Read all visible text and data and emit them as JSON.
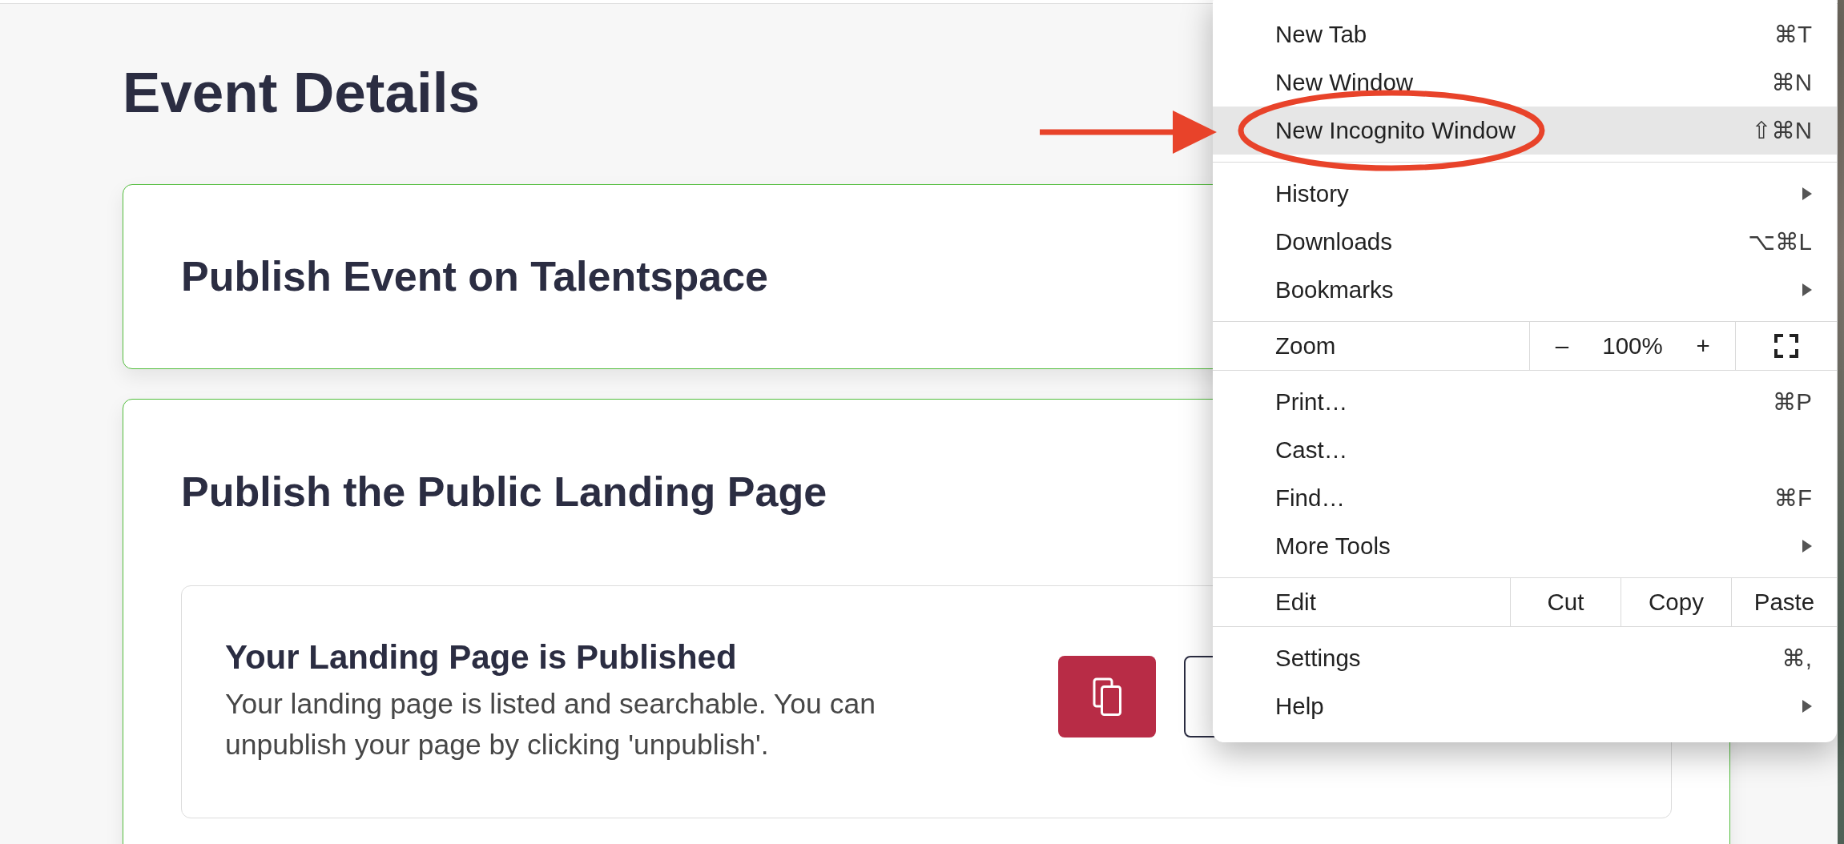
{
  "page": {
    "title": "Event Details"
  },
  "cards": [
    {
      "title": "Publish Event on Talentspace"
    },
    {
      "title": "Publish the Public Landing Page",
      "notice": {
        "title": "Your Landing Page is Published",
        "text": "Your landing page is listed and searchable. You can unpublish your page by clicking 'unpublish'.",
        "actions": [
          {
            "kind": "copy"
          },
          {
            "kind": "outline"
          }
        ]
      }
    }
  ],
  "menu": {
    "sections": [
      {
        "kind": "list",
        "items": [
          {
            "label": "New Tab",
            "shortcut": "⌘T",
            "submenu": false,
            "highlighted": false,
            "circled": false
          },
          {
            "label": "New Window",
            "shortcut": "⌘N",
            "submenu": false,
            "highlighted": false,
            "circled": false
          },
          {
            "label": "New Incognito Window",
            "shortcut": "⇧⌘N",
            "submenu": false,
            "highlighted": true,
            "circled": true
          }
        ]
      },
      {
        "kind": "list",
        "items": [
          {
            "label": "History",
            "submenu": true,
            "highlighted": false,
            "circled": false
          },
          {
            "label": "Downloads",
            "shortcut": "⌥⌘L",
            "submenu": false,
            "highlighted": false,
            "circled": false
          },
          {
            "label": "Bookmarks",
            "submenu": true,
            "highlighted": false,
            "circled": false
          }
        ]
      },
      {
        "kind": "zoom",
        "label": "Zoom",
        "decrease": "–",
        "value": "100%",
        "increase": "+"
      },
      {
        "kind": "list",
        "items": [
          {
            "label": "Print…",
            "shortcut": "⌘P",
            "submenu": false,
            "highlighted": false,
            "circled": false
          },
          {
            "label": "Cast…",
            "submenu": false,
            "highlighted": false,
            "circled": false
          },
          {
            "label": "Find…",
            "shortcut": "⌘F",
            "submenu": false,
            "highlighted": false,
            "circled": false
          },
          {
            "label": "More Tools",
            "submenu": true,
            "highlighted": false,
            "circled": false
          }
        ]
      },
      {
        "kind": "edit",
        "label": "Edit",
        "actions": [
          "Cut",
          "Copy",
          "Paste"
        ]
      },
      {
        "kind": "list",
        "items": [
          {
            "label": "Settings",
            "shortcut": "⌘,",
            "submenu": false,
            "highlighted": false,
            "circled": false
          },
          {
            "label": "Help",
            "submenu": true,
            "highlighted": false,
            "circled": false
          }
        ]
      }
    ]
  },
  "annotations": [
    {
      "kind": "arrow"
    }
  ]
}
